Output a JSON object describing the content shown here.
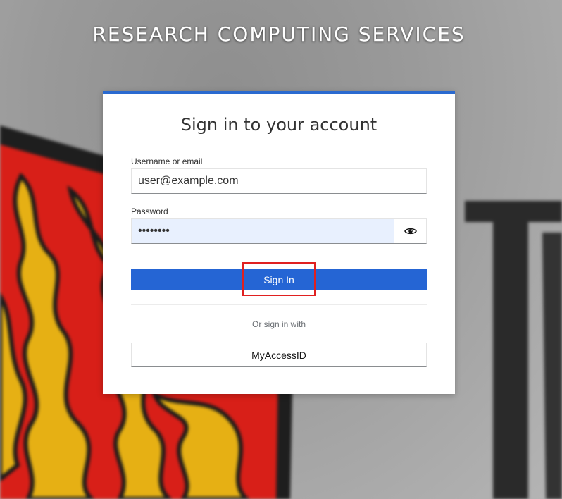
{
  "header": {
    "title": "RESEARCH COMPUTING SERVICES"
  },
  "login": {
    "heading": "Sign in to your account",
    "username": {
      "label": "Username or email",
      "value": "user@example.com"
    },
    "password": {
      "label": "Password",
      "value": "password",
      "toggle_icon": "eye-icon"
    },
    "signin_label": "Sign In",
    "divider_text": "Or sign in with",
    "providers": [
      {
        "label": "MyAccessID"
      }
    ]
  },
  "colors": {
    "accent": "#2565d4",
    "card_border_top": "#2a6ad0",
    "highlight": "#e02020",
    "autofill_bg": "#e8f0fe"
  }
}
